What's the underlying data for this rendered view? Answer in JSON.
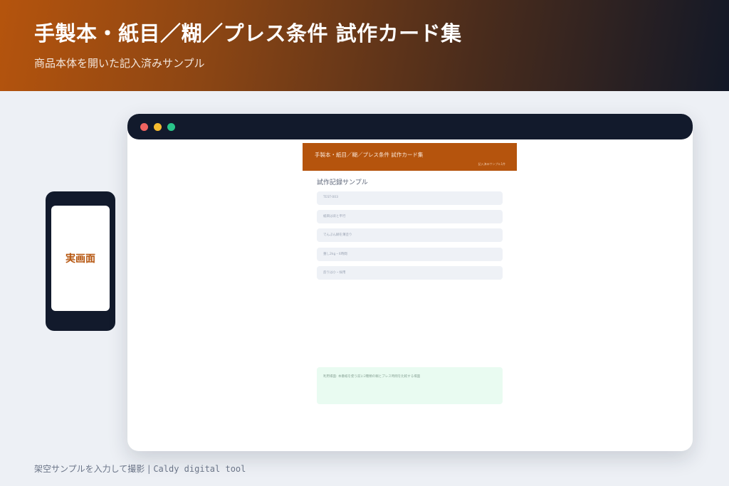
{
  "hero": {
    "title": "手製本・紙目／糊／プレス条件 試作カード集",
    "subtitle": "商品本体を開いた記入済みサンプル"
  },
  "phone": {
    "label": "実画面"
  },
  "app": {
    "header_title": "手製本・紙目／糊／プレス条件 試作カード集",
    "header_meta": "記入済みサンプル1件",
    "section_title": "試作記録サンプル",
    "fields": [
      {
        "value": "TEST-003"
      },
      {
        "value": "紙目は背と平行"
      },
      {
        "value": "でんぷん糊を薄塗り"
      },
      {
        "value": "重し2kg・6時間"
      },
      {
        "value": "反りは小・採用"
      }
    ],
    "note": "利用場面: 本番紙を使う前に2種類の糊とプレス時間を比較する場面"
  },
  "footer": {
    "caption": "架空サンプルを入力して撮影",
    "separator": "|",
    "brand": "Caldy digital tool"
  },
  "colors": {
    "accent": "#b5540d",
    "dark": "#121a2c",
    "background": "#edf0f5"
  }
}
